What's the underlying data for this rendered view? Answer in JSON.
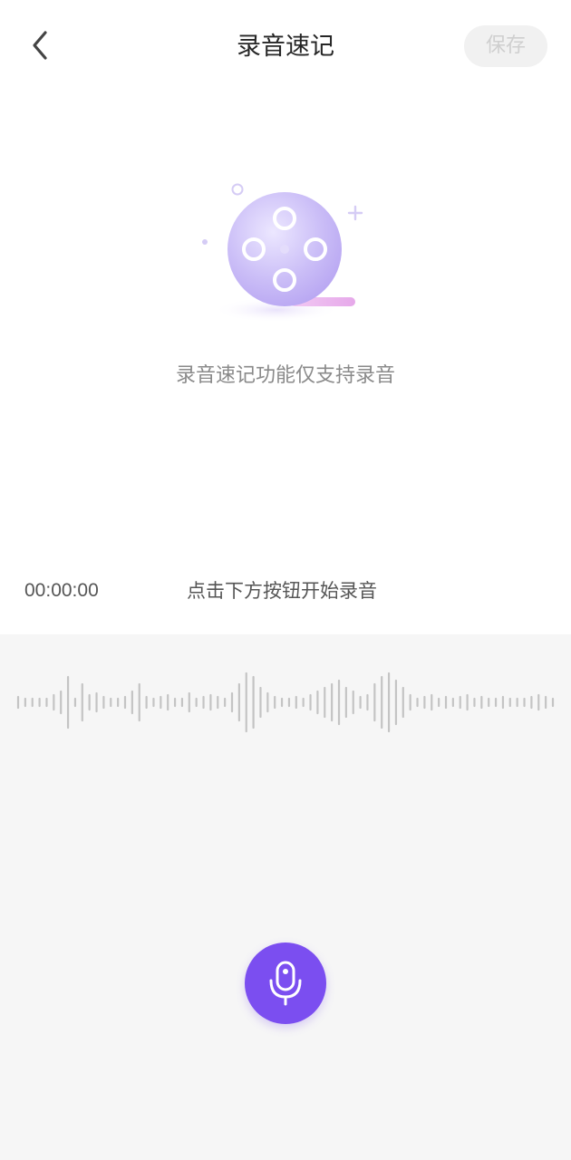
{
  "header": {
    "title": "录音速记",
    "save_label": "保存"
  },
  "empty_state": {
    "hint": "录音速记功能仅支持录音"
  },
  "recording": {
    "timer": "00:00:00",
    "status": "点击下方按钮开始录音"
  },
  "icons": {
    "back": "chevron-left-icon",
    "illustration": "film-reel-icon",
    "mic": "microphone-icon"
  },
  "colors": {
    "accent": "#7b4ef0",
    "waveform": "#c4c4c4",
    "panel_bg": "#f6f6f6"
  }
}
